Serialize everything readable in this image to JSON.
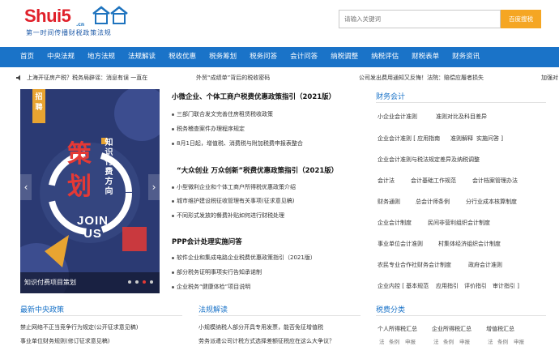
{
  "logo": {
    "text_main": "Shui5",
    "text_cn": ".cn",
    "text_house": "税屋",
    "tagline": "第一时间传播财税政策法规"
  },
  "search": {
    "placeholder": "请输入关键词",
    "button": "百度搜税"
  },
  "nav": [
    "首页",
    "中央法规",
    "地方法规",
    "法规解读",
    "税收优惠",
    "税务筹划",
    "税务问答",
    "会计问答",
    "纳税调整",
    "纳税评估",
    "财税表单",
    "财务资讯"
  ],
  "ticker": [
    "上海开征房产税？税务局辟谣：消息有误 一直在",
    "外贸“成绩单”背后的税收密码",
    "公司发出费用通知又反悔！法院：赔偿应履者损失",
    "加强对"
  ],
  "slider": {
    "badge": "招聘",
    "big1": "策",
    "big2": "划",
    "vertical": "知识付费方向",
    "join1": "JOIN",
    "join2": "US",
    "caption": "知识付费项目策划",
    "dots": 4,
    "active_dot": 3
  },
  "mid": {
    "blocks": [
      {
        "title": "小微企业、个体工商户税费优惠政策指引（2021版）",
        "items": [
          "三部门联合发文完善住房租赁税收政策",
          "税务稽查案件办理程序规定",
          "8月1日起，增值税、消费税与附加税费申报表整合"
        ]
      },
      {
        "title": "“大众创业 万众创新”税费优惠政策指引（2021版）",
        "items": [
          "小型微利企业和个体工商户所得税优惠政策介绍",
          "城市维护建设税征收管理有关事项(征求意见稿)",
          "不同形式发放的餐费补贴如何进行财税处理"
        ]
      },
      {
        "title": "PPP会计处理实施问答",
        "items": [
          "软件企业和集成电路企业税费优惠政策指引（2021版）",
          "部分税务证明事项实行告知承诺制",
          "企业税务“健康体检”项目说明"
        ]
      }
    ]
  },
  "right": {
    "title": "财务会计",
    "tags": [
      [
        "小企业会计准则",
        "准则对比及科目差异"
      ],
      [
        "企业会计准则 [ 应用指南",
        "准则解释",
        "实施问答 ]"
      ],
      [
        "企业会计准则与税法规定差异及纳税调整"
      ],
      [
        "会计法",
        "会计基础工作规范",
        "会计档案管理办法"
      ],
      [
        "财务通则",
        "总会计师条例",
        "分行业成本核算制度"
      ],
      [
        "企业会计制度",
        "民间非营利组织会计制度"
      ],
      [
        "事业单位会计准则",
        "村集体经济组织会计制度"
      ],
      [
        "农民专业合作社财务会计制度",
        "政府会计准则"
      ],
      [
        "企业内控 [ 基本规范",
        "应用指引",
        "评价指引",
        "审计指引 ]"
      ]
    ]
  },
  "bottom": {
    "sections": [
      {
        "title": "最新中央政策",
        "items": [
          "禁止网络不正当竞争行为规定(公开征求意见稿)",
          "事业单位财务规则(修订征求意见稿)"
        ]
      },
      {
        "title": "法规解读",
        "items": [
          "小规模纳税人部分开具专用发票，能否免征增值税",
          "劳务派遣公司计税方式选择差额征税应在这么大争议？"
        ]
      },
      {
        "title": "税费分类",
        "items": [
          "个人所得税汇总",
          "企业所得税汇总",
          "增值税汇总"
        ]
      }
    ],
    "tax_sub": [
      "法",
      "条例",
      "申报",
      "法",
      "条例",
      "申报",
      "法",
      "条例",
      "申报"
    ]
  },
  "colors": {
    "brand_blue": "#1a73c8",
    "brand_red": "#e0202a",
    "search_orange": "#f5a623"
  }
}
